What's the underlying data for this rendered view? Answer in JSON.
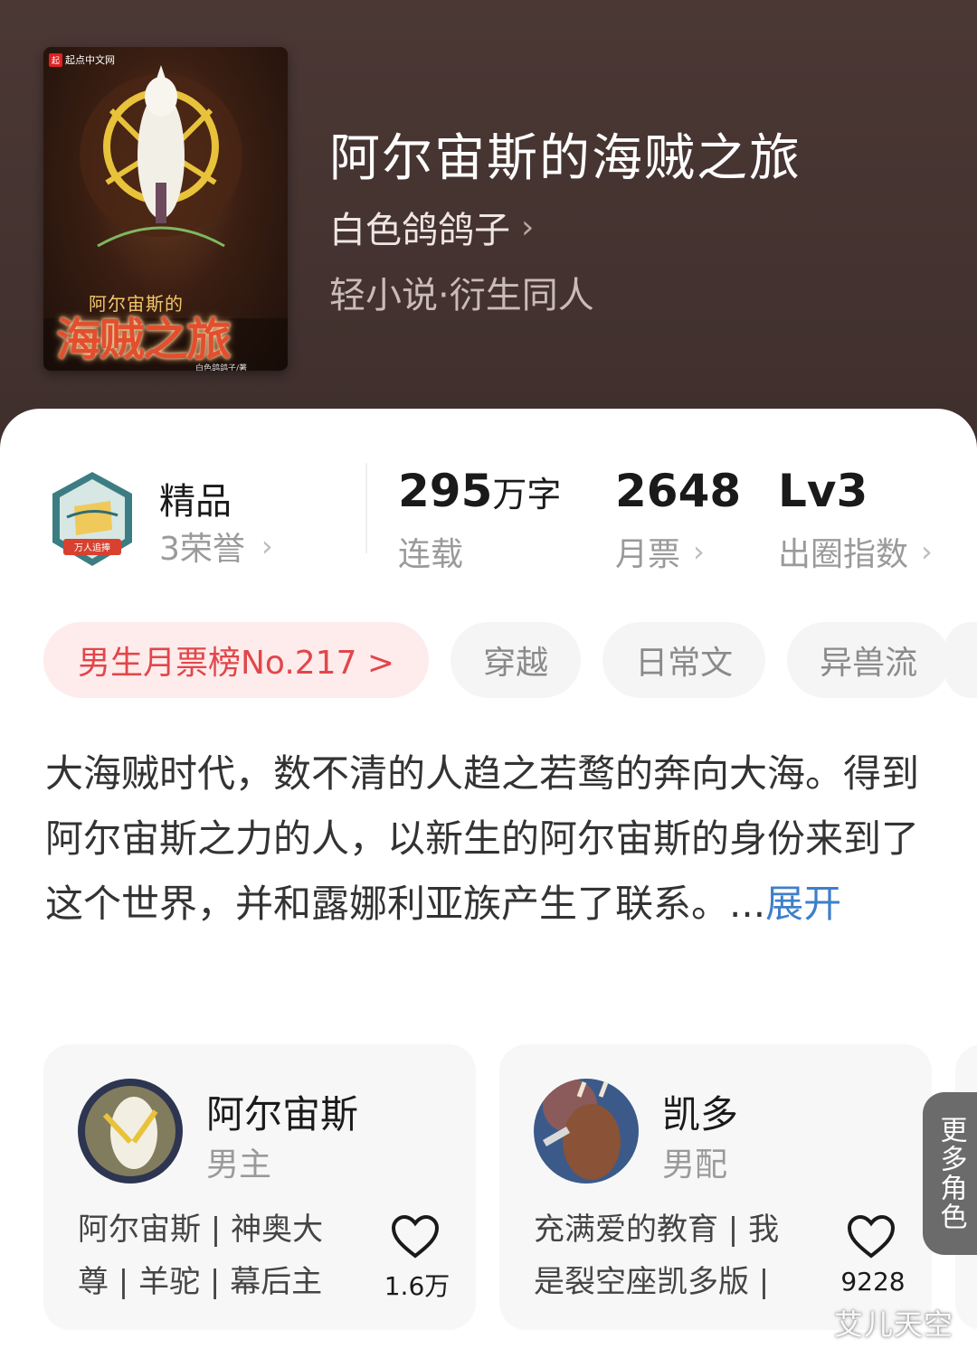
{
  "book": {
    "cover_publisher": "起点中文网",
    "cover_publisher_badge": "起",
    "cover_small_title": "阿尔宙斯的",
    "cover_big_title": "海贼之旅",
    "cover_author": "白色鸽鸽子/著",
    "title": "阿尔宙斯的海贼之旅",
    "author": "白色鸽鸽子",
    "genre": "轻小说·衍生同人"
  },
  "honor": {
    "badge_text": "万人追捧",
    "title": "精品",
    "subtitle": "3荣誉"
  },
  "stats": [
    {
      "value": "295",
      "unit": "万字",
      "label": "连载"
    },
    {
      "value": "2648",
      "unit": "",
      "label": "月票"
    },
    {
      "value": "Lv3",
      "unit": "",
      "label": "出圈指数"
    }
  ],
  "tags": {
    "rank": "男生月票榜No.217 >",
    "items": [
      "穿越",
      "日常文",
      "异兽流"
    ]
  },
  "description": {
    "text": "大海贼时代，数不清的人趋之若鹜的奔向大海。得到阿尔宙斯之力的人，以新生的阿尔宙斯的身份来到了这个世界，并和露娜利亚族产生了联系。...",
    "expand": "展开"
  },
  "roles": [
    {
      "name": "阿尔宙斯",
      "type": "男主",
      "desc": "阿尔宙斯 | 神奥大尊 | 羊驼 | 幕后主使",
      "likes": "1.6万"
    },
    {
      "name": "凯多",
      "type": "男配",
      "desc": "充满爱的教育 | 我是裂空座凯多版 | ...",
      "likes": "9228"
    }
  ],
  "more_roles": "更多角色",
  "watermark": "艾儿天空",
  "colors": {
    "header_bg": "#4b3835",
    "rank_tag_text": "#e2464a",
    "rank_tag_bg": "#fdeceb",
    "link": "#3f7fc9"
  }
}
